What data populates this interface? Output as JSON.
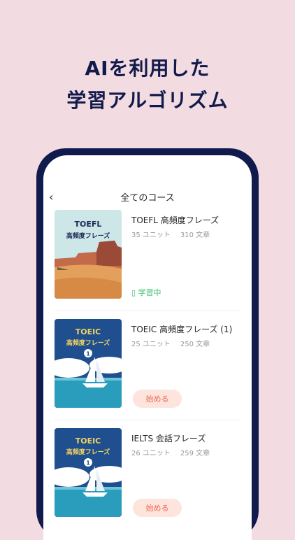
{
  "headline": {
    "line1": "AIを利用した",
    "line2": "学習アルゴリズム"
  },
  "nav": {
    "back": "‹",
    "title": "全てのコース"
  },
  "courses": [
    {
      "thumb_title": "TOEFL",
      "thumb_subtitle": "高頻度フレーズ",
      "title": "TOEFL 高頻度フレーズ",
      "units": "35 ユニット",
      "sentences": "310 文章",
      "status": "学習中"
    },
    {
      "thumb_title": "TOEIC",
      "thumb_subtitle": "高頻度フレーズ",
      "thumb_badge": "1",
      "title": "TOEIC 高頻度フレーズ (1)",
      "units": "25 ユニット",
      "sentences": "250 文章",
      "action": "始める"
    },
    {
      "thumb_title": "TOEIC",
      "thumb_subtitle": "高頻度フレーズ",
      "thumb_badge": "1",
      "title": "IELTS 会話フレーズ",
      "units": "26 ユニット",
      "sentences": "259 文章",
      "action": "始める"
    }
  ]
}
